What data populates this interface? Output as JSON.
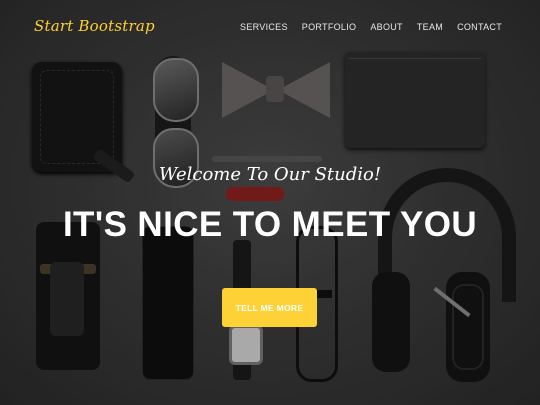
{
  "nav": {
    "brand": "Start Bootstrap",
    "links": [
      "SERVICES",
      "PORTFOLIO",
      "ABOUT",
      "TEAM",
      "CONTACT"
    ]
  },
  "hero": {
    "lead": "Welcome To Our Studio!",
    "heading": "IT'S NICE TO MEET YOU",
    "cta_label": "TELL ME MORE"
  },
  "colors": {
    "accent": "#fed136",
    "text": "#ffffff"
  }
}
